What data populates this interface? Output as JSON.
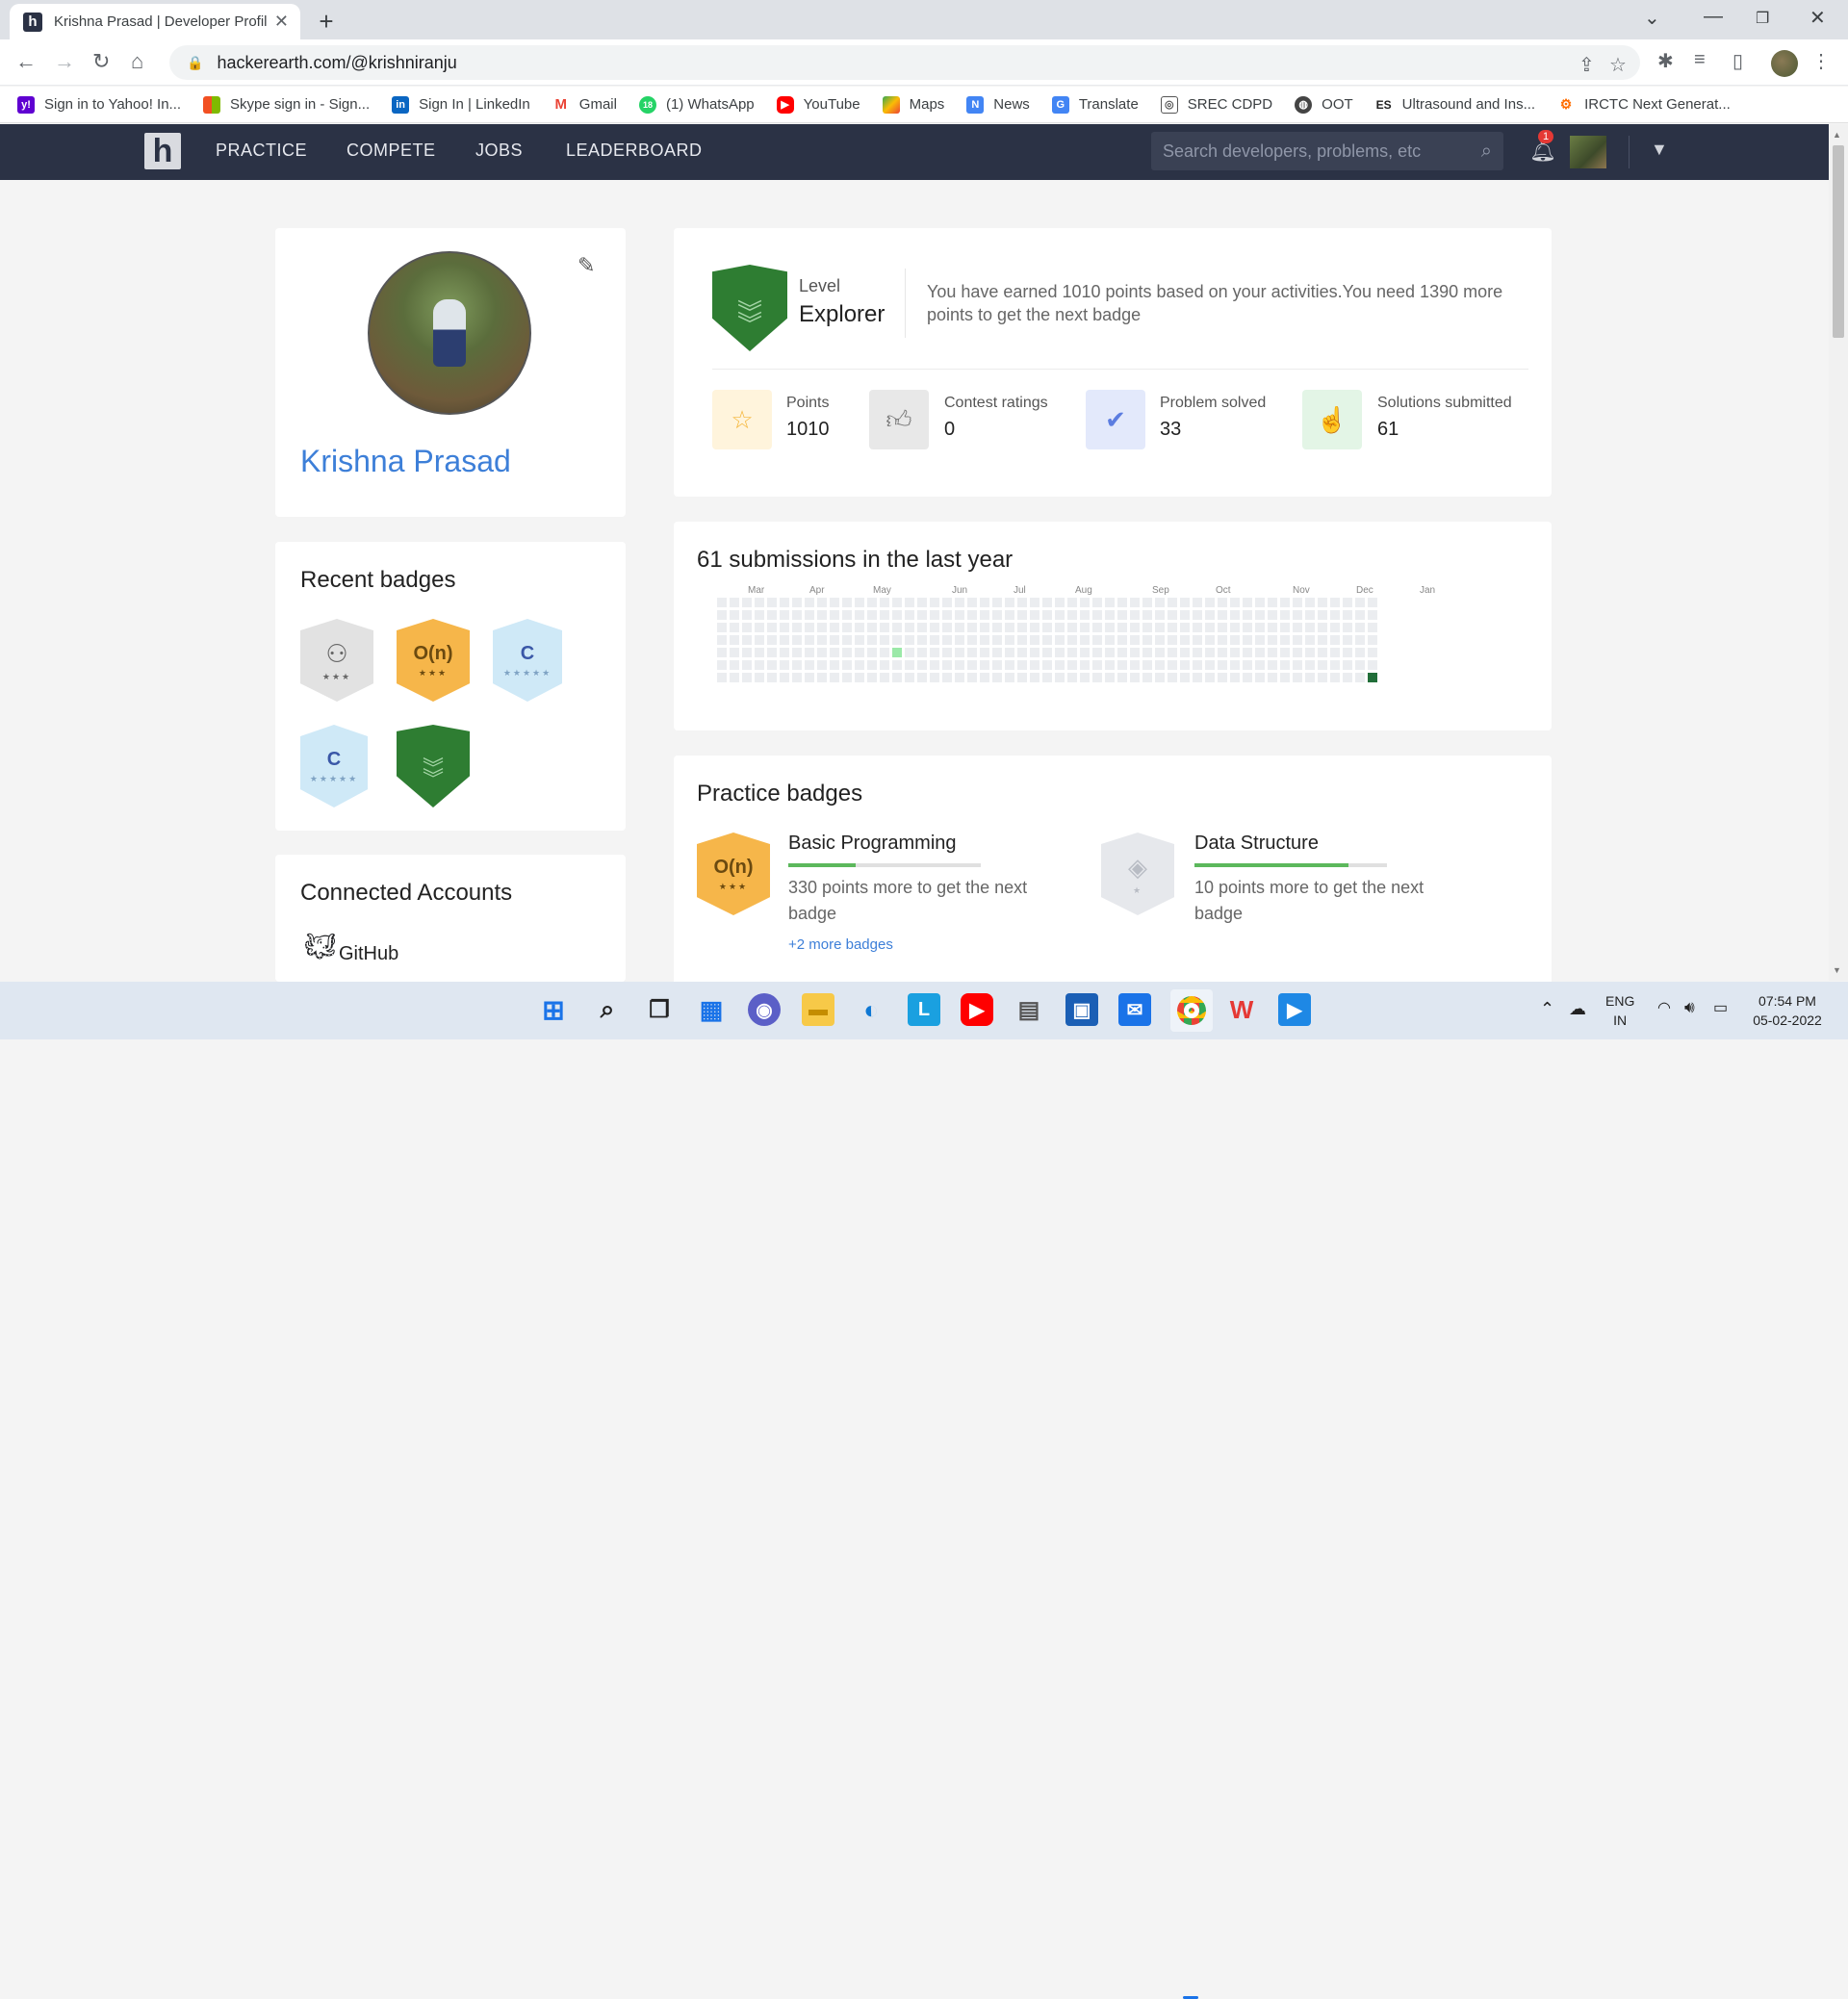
{
  "browser": {
    "tab_title": "Krishna Prasad | Developer Profil",
    "url": "hackerearth.com/@krishniranju",
    "bookmarks": [
      "Sign in to Yahoo! In...",
      "Skype sign in - Sign...",
      "Sign In | LinkedIn",
      "Gmail",
      "(1) WhatsApp",
      "YouTube",
      "Maps",
      "News",
      "Translate",
      "SREC CDPD",
      "OOT",
      "Ultrasound and Ins...",
      "IRCTC Next Generat..."
    ],
    "bookmark_colors": [
      "#5f01d1",
      "#f25022",
      "#0a66c2",
      "#ea4335",
      "#25d366",
      "#ff0000",
      "#34a853",
      "#4285f4",
      "#4285f4",
      "#555555",
      "#444444",
      "#222222",
      "#ff6d00"
    ]
  },
  "nav": {
    "logo": "h",
    "links": [
      "PRACTICE",
      "COMPETE",
      "JOBS",
      "LEADERBOARD"
    ],
    "search_placeholder": "Search developers, problems, etc",
    "notifications": "1"
  },
  "profile": {
    "name": "Krishna Prasad"
  },
  "recent_badges": {
    "title": "Recent badges",
    "items": [
      {
        "icon": "hierarchy-icon",
        "text": "",
        "stars": "★★★",
        "color": "#e0e0e0"
      },
      {
        "icon": "",
        "text": "O(n)",
        "stars": "★★★",
        "color": "#f6b64a"
      },
      {
        "icon": "c-language-icon",
        "text": "C",
        "stars": "★★★★★",
        "color": "#cfe9f7"
      },
      {
        "icon": "cpp-language-icon",
        "text": "C",
        "stars": "★★★★★",
        "color": "#cfe9f7"
      },
      {
        "icon": "level-shield-icon",
        "text": "",
        "stars": "",
        "color": "#2e7d32"
      }
    ]
  },
  "connected": {
    "title": "Connected Accounts",
    "items": [
      "GitHub"
    ]
  },
  "level": {
    "label": "Level",
    "name": "Explorer",
    "message": "You have earned 1010 points based on your activities.You need 1390 more points to get the next badge"
  },
  "stats": [
    {
      "label": "Points",
      "value": "1010",
      "icon": "star-icon",
      "bg": "#fff4dc",
      "fg": "#f5b63a"
    },
    {
      "label": "Contest ratings",
      "value": "0",
      "icon": "thumbs-up-icon",
      "bg": "#e8e8e8",
      "fg": "#777777"
    },
    {
      "label": "Problem solved",
      "value": "33",
      "icon": "check-circle-icon",
      "bg": "#e3e9fb",
      "fg": "#5c7de0"
    },
    {
      "label": "Solutions submitted",
      "value": "61",
      "icon": "pointer-hand-icon",
      "bg": "#e3f5e6",
      "fg": "#4cb26a"
    }
  ],
  "activity": {
    "title": "61 submissions in the last year",
    "months": [
      "Mar",
      "Apr",
      "May",
      "Jun",
      "Jul",
      "Aug",
      "Sep",
      "Oct",
      "Nov",
      "Dec",
      "Jan"
    ]
  },
  "practice_badges": {
    "title": "Practice badges",
    "items": [
      {
        "title": "Basic Programming",
        "desc": "330 points more to get the next badge",
        "progress": 0.35,
        "badge_text": "O(n)",
        "stars": "★★★",
        "color": "#f6b64a"
      },
      {
        "title": "Data Structure",
        "desc": "10 points more to get the next badge",
        "progress": 0.8,
        "badge_text": "",
        "stars": "★",
        "color": "#e6e8ec"
      }
    ],
    "more": "+2 more badges"
  },
  "taskbar": {
    "lang1": "ENG",
    "lang2": "IN",
    "time": "07:54 PM",
    "date": "05-02-2022"
  }
}
